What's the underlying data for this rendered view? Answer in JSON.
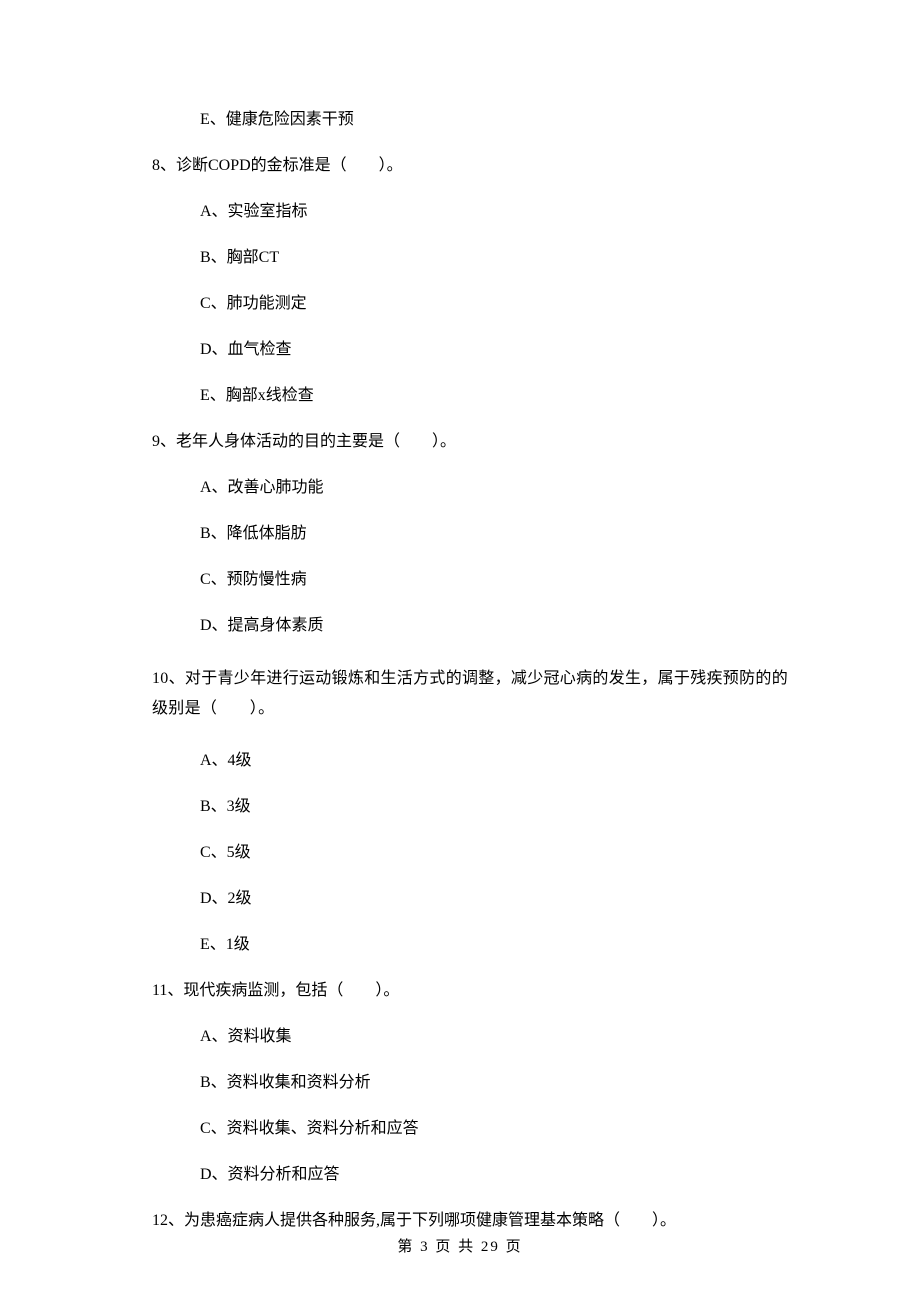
{
  "lines": {
    "l1": "E、健康危险因素干预",
    "l2": "8、诊断COPD的金标准是（　　）。",
    "l3": "A、实验室指标",
    "l4": "B、胸部CT",
    "l5": "C、肺功能测定",
    "l6": "D、血气检查",
    "l7": "E、胸部x线检查",
    "l8": "9、老年人身体活动的目的主要是（　　）。",
    "l9": "A、改善心肺功能",
    "l10": "B、降低体脂肪",
    "l11": "C、预防慢性病",
    "l12": "D、提高身体素质",
    "l13": "10、对于青少年进行运动锻炼和生活方式的调整，减少冠心病的发生，属于残疾预防的的级别是（　　）。",
    "l14": "A、4级",
    "l15": "B、3级",
    "l16": "C、5级",
    "l17": "D、2级",
    "l18": "E、1级",
    "l19": "11、现代疾病监测，包括（　　）。",
    "l20": "A、资料收集",
    "l21": "B、资料收集和资料分析",
    "l22": "C、资料收集、资料分析和应答",
    "l23": "D、资料分析和应答",
    "l24": "12、为患癌症病人提供各种服务,属于下列哪项健康管理基本策略（　　）。"
  },
  "footer": "第 3 页 共 29 页"
}
